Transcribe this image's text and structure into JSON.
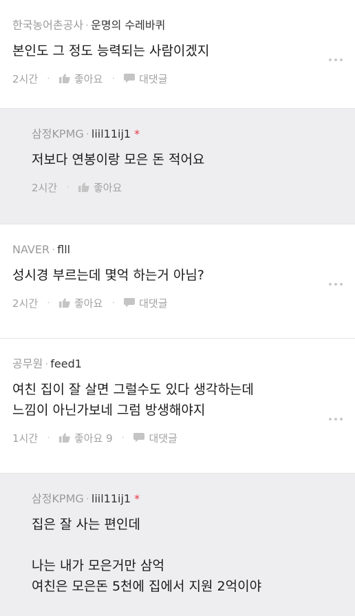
{
  "comments": [
    {
      "company": "한국농어촌공사",
      "nickname": "운명의 수레바퀴",
      "lines": [
        "본인도 그 정도 능력되는 사람이겠지"
      ],
      "time": "2시간",
      "like_label": "좋아요",
      "reply_label": "대댓글"
    },
    {
      "company": "삼정KPMG",
      "nickname": "liil11ij1",
      "author_mark": "*",
      "lines": [
        "저보다 연봉이랑 모은 돈 적어요"
      ],
      "time": "2시간",
      "like_label": "좋아요"
    },
    {
      "company": "NAVER",
      "nickname": "flll",
      "lines": [
        "성시경 부르는데 몇억 하는거 아님?"
      ],
      "time": "2시간",
      "like_label": "좋아요",
      "reply_label": "대댓글"
    },
    {
      "company": "공무원",
      "nickname": "feed1",
      "lines": [
        "여친 집이 잘 살면 그럴수도 있다 생각하는데",
        "느낌이 아닌가보네 그럼 방생해야지"
      ],
      "time": "1시간",
      "like_label": "좋아요 9",
      "reply_label": "대댓글"
    },
    {
      "company": "삼정KPMG",
      "nickname": "liil11ij1",
      "author_mark": "*",
      "lines": [
        "집은 잘 사는 편인데",
        "",
        "나는 내가 모은거만 삼억",
        "여친은 모은돈 5천에 집에서 지원 2억이야"
      ]
    }
  ],
  "colors": {
    "reply_bg": "#eeeef0",
    "author_mark": "#e8374a",
    "meta_text": "#9a9a9a"
  },
  "icons": {
    "like": "thumbs-up-icon",
    "reply": "speech-bubble-icon",
    "more": "more-dots-icon"
  }
}
